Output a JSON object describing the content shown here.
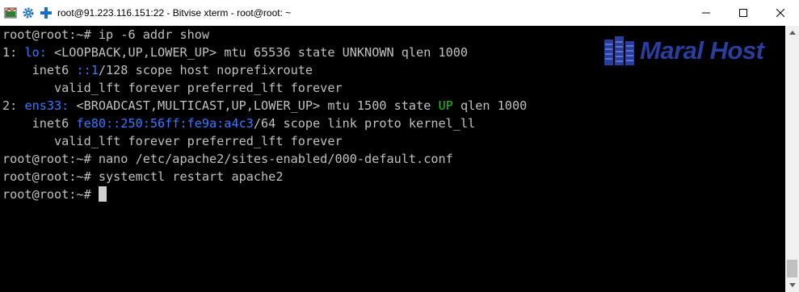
{
  "window": {
    "title": "root@91.223.116.151:22 - Bitvise xterm - root@root: ~",
    "icons": [
      "terminal-app-icon",
      "gear-icon",
      "plus-icon"
    ],
    "controls": [
      "minimize",
      "maximize",
      "close"
    ]
  },
  "terminal": {
    "lines": [
      [
        {
          "t": "root@root:~# ip -6 addr show"
        }
      ],
      [
        {
          "t": "1: "
        },
        {
          "t": "lo:",
          "c": "blue"
        },
        {
          "t": " <LOOPBACK,UP,LOWER_UP> mtu 65536 state UNKNOWN qlen 1000"
        }
      ],
      [
        {
          "t": "    inet6 "
        },
        {
          "t": "::1",
          "c": "blue"
        },
        {
          "t": "/128 scope host noprefixroute"
        }
      ],
      [
        {
          "t": "       valid_lft forever preferred_lft forever"
        }
      ],
      [
        {
          "t": "2: "
        },
        {
          "t": "ens33:",
          "c": "blue"
        },
        {
          "t": " <BROADCAST,MULTICAST,UP,LOWER_UP> mtu 1500 state "
        },
        {
          "t": "UP",
          "c": "green"
        },
        {
          "t": " qlen 1000"
        }
      ],
      [
        {
          "t": "    inet6 "
        },
        {
          "t": "fe80::250:56ff:fe9a:a4c3",
          "c": "blue"
        },
        {
          "t": "/64 scope link proto kernel_ll"
        }
      ],
      [
        {
          "t": "       valid_lft forever preferred_lft forever"
        }
      ],
      [
        {
          "t": "root@root:~# nano /etc/apache2/sites-enabled/000-default.conf"
        }
      ],
      [
        {
          "t": "root@root:~# systemctl restart apache2"
        }
      ],
      [
        {
          "t": "root@root:~# "
        },
        {
          "cursor": true
        }
      ]
    ]
  },
  "watermark": {
    "text": "Maral Host"
  },
  "colors": {
    "blue": "#3b78ff",
    "green": "#16c60c",
    "fg": "#c0c0c0",
    "bg": "#000000",
    "logo": "#2a3e9e"
  }
}
